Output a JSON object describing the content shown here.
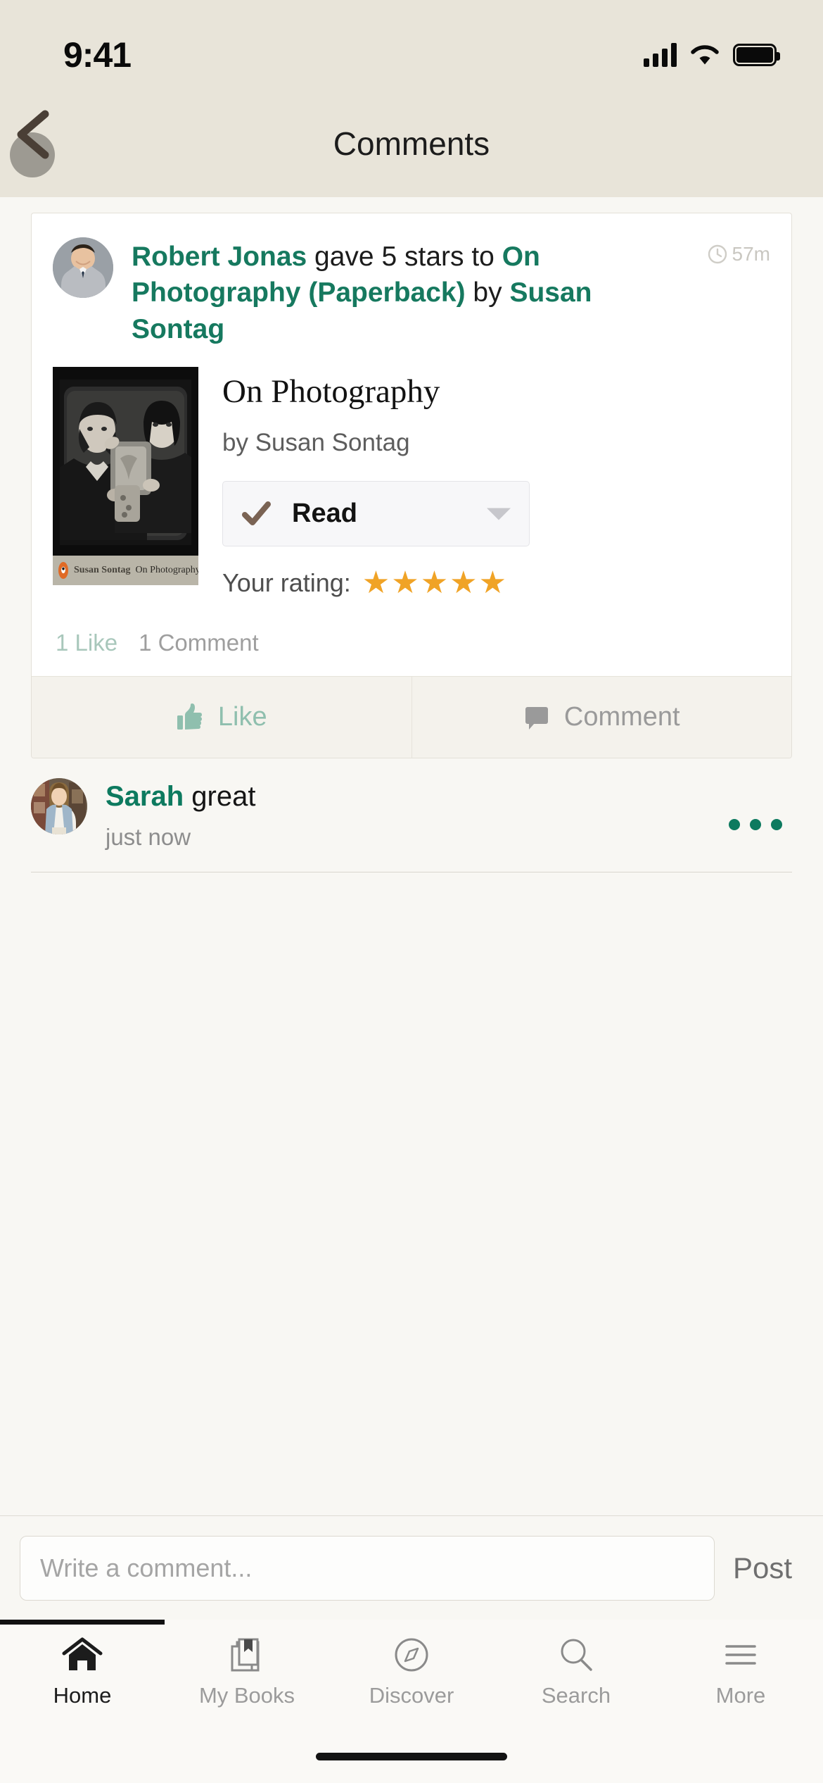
{
  "status_bar": {
    "time": "9:41",
    "signal_icon": "cellular-signal-icon",
    "wifi_icon": "wifi-icon",
    "battery_icon": "battery-icon"
  },
  "nav": {
    "title": "Comments",
    "back_icon": "back-chevron-icon"
  },
  "post": {
    "avatar_name": "robert-jonas-avatar",
    "actor": "Robert Jonas",
    "action": " gave 5 stars to ",
    "book_link": "On Photography (Paperback)",
    "by_word": " by ",
    "author_link": "Susan Sontag",
    "timestamp": "57m",
    "clock_icon": "clock-icon",
    "book": {
      "cover_name": "on-photography-book-cover",
      "cover_band_author": "Susan Sontag",
      "cover_band_title": "On Photography",
      "title": "On Photography",
      "author": "by Susan Sontag",
      "shelf_status": "Read",
      "shelf_check_icon": "check-icon",
      "shelf_caret_icon": "chevron-down-icon",
      "rating_label": "Your rating:",
      "rating_value": 5,
      "stars": [
        "★",
        "★",
        "★",
        "★",
        "★"
      ],
      "star_color": "#f0a326"
    },
    "likes_count_label": "1 Like",
    "comments_count_label": "1 Comment",
    "like_button_label": "Like",
    "like_icon": "thumbs-up-icon",
    "comment_button_label": "Comment",
    "comment_icon": "speech-bubble-icon"
  },
  "comments": [
    {
      "avatar_name": "sarah-avatar",
      "author": "Sarah",
      "text": "great",
      "time": "just now",
      "menu_icon": "more-options-icon"
    }
  ],
  "composer": {
    "placeholder": "Write a comment...",
    "value": "",
    "post_label": "Post"
  },
  "tab_bar": {
    "active_index": 0,
    "tabs": [
      {
        "label": "Home",
        "icon": "home-icon"
      },
      {
        "label": "My Books",
        "icon": "books-bookmark-icon"
      },
      {
        "label": "Discover",
        "icon": "compass-icon"
      },
      {
        "label": "Search",
        "icon": "magnifier-icon"
      },
      {
        "label": "More",
        "icon": "hamburger-menu-icon"
      }
    ]
  },
  "colors": {
    "brand_green": "#16795f",
    "header_bg": "#e8e4d9",
    "page_bg": "#f8f7f3",
    "star": "#f0a326",
    "check_brown": "#7a6354"
  }
}
